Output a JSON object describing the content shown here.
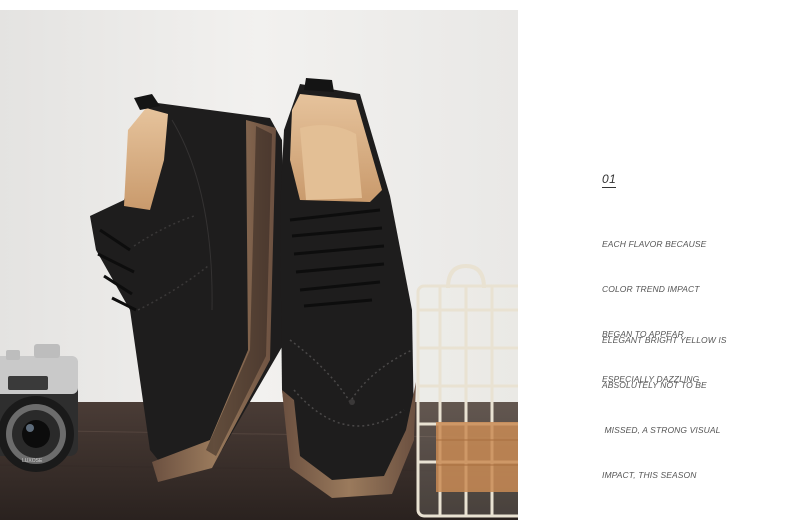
{
  "copy": {
    "number": "01",
    "paragraph1": [
      "EACH FLAVOR BECAUSE",
      "COLOR TREND IMPACT",
      "BEGAN TO APPEAR",
      "ESPECIALLY DAZZLING"
    ],
    "paragraph2": [
      "ELEGANT BRIGHT YELLOW IS",
      "ABSOLUTELY NOT TO BE",
      " MISSED, A STRONG VISUAL",
      "IMPACT, THIS SEASON"
    ]
  },
  "photo": {
    "camera_brand": "LUXOSE",
    "colors": {
      "wall": "#ecebe9",
      "floor": "#3a2f2b",
      "shoe": "#1e1d1d",
      "sole": "#8a6a4e",
      "lining": "#d9b28a",
      "basket": "#e9e2d2"
    }
  }
}
